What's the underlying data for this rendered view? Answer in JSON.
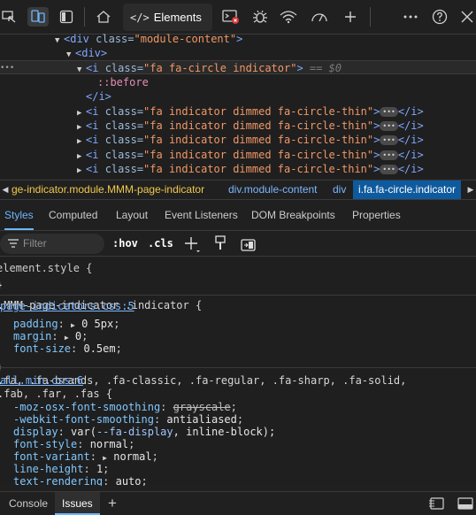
{
  "toolbar": {
    "elements_label": "Elements",
    "elements_glyph": "</>",
    "icons": [
      "device-emulation-icon",
      "inspect-icon",
      "dock-icon",
      "welcome-home-icon",
      "console-icon",
      "bug-icon",
      "network-wifi-icon",
      "performance-gauge-icon",
      "add-tab-icon",
      "more-icon",
      "help-icon",
      "close-icon"
    ]
  },
  "dom": {
    "lines": {
      "module_div": {
        "tag_open": "<div",
        "attr": "class",
        "val": "\"module-content\"",
        "tag_close": ">"
      },
      "div": {
        "text": "<div>"
      },
      "selected": {
        "tag_open": "<i",
        "attr": "class",
        "val": "\"fa fa-circle indicator\"",
        "tag_close": ">",
        "eq0": "== $0"
      },
      "before": {
        "text": "::before"
      },
      "close_i": {
        "text": "</i>"
      },
      "dimmed": {
        "tag_open": "<i",
        "attr": "class",
        "val": "\"fa indicator dimmed fa-circle-thin\"",
        "tag_close": ">",
        "end": "</i>",
        "badge": "•••"
      }
    },
    "gutter": "•••"
  },
  "breadcrumbs": [
    {
      "text": "ge-indicator.module.MMM-page-indicator",
      "kind": "module"
    },
    {
      "text": "div.module-content",
      "kind": "normal"
    },
    {
      "text": "div",
      "kind": "normal"
    },
    {
      "text": "i.fa.fa-circle.indicator",
      "kind": "selected"
    }
  ],
  "subtabs": {
    "styles": "Styles",
    "computed": "Computed",
    "layout": "Layout",
    "listeners": "Event Listeners",
    "dom_bp": "DOM Breakpoints",
    "properties": "Properties"
  },
  "filterbar": {
    "placeholder": "Filter",
    "hov": ":hov",
    "cls": ".cls"
  },
  "styles": {
    "element_style": "element.style {",
    "close_brace": "}",
    "rule1": {
      "selector": ".MMM-page-indicator .indicator {",
      "source": "page-indicators.css:5",
      "props": [
        {
          "name": "padding",
          "value": "0 5px",
          "expand": true
        },
        {
          "name": "margin",
          "value": "0",
          "expand": true
        },
        {
          "name": "font-size",
          "value": "0.5em",
          "expand": false
        }
      ]
    },
    "rule2": {
      "selector_line1": ".fa, .fa-brands, .fa-classic, .fa-regular, .fa-sharp, .fa-solid,",
      "selector_line2": ".fab, .far, .fas {",
      "source": "all.min.css:6",
      "props": [
        {
          "name": "-moz-osx-font-smoothing",
          "value": "grayscale",
          "strike": true
        },
        {
          "name": "-webkit-font-smoothing",
          "value": "antialiased"
        },
        {
          "name": "display",
          "value_pre": "var(",
          "value_var": "--fa-display",
          "value_post": ", inline-block);"
        },
        {
          "name": "font-style",
          "value": "normal"
        },
        {
          "name": "font-variant",
          "value": "normal",
          "expand": true
        },
        {
          "name": "line-height",
          "value": "1"
        },
        {
          "name": "text-rendering",
          "value": "auto"
        }
      ]
    }
  },
  "drawer": {
    "console": "Console",
    "issues": "Issues",
    "add": "+"
  }
}
